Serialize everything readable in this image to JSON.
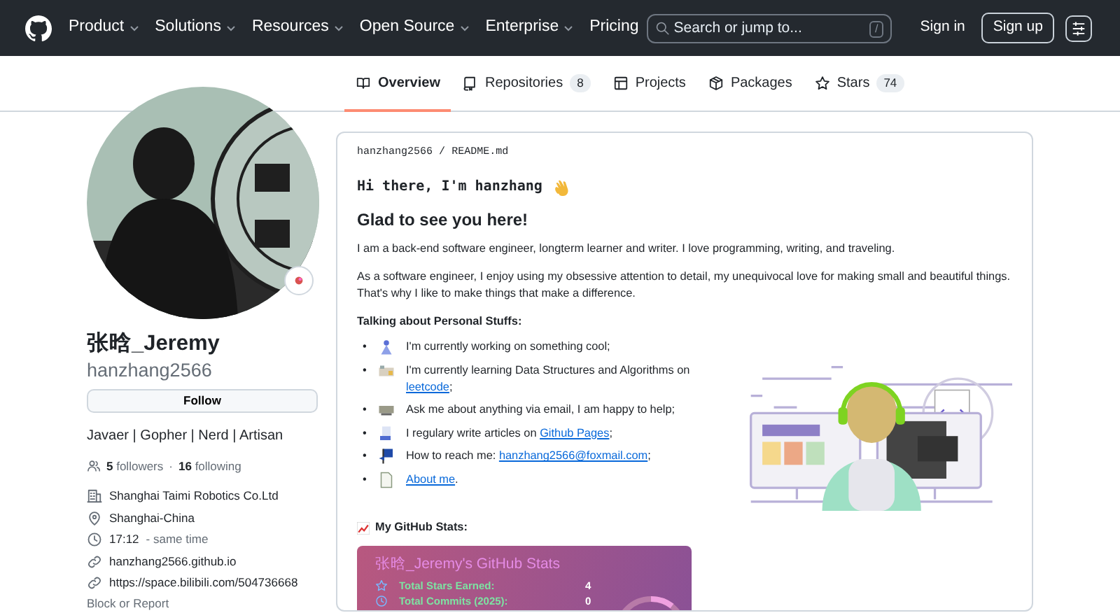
{
  "nav": {
    "items": [
      {
        "label": "Product",
        "dropdown": true
      },
      {
        "label": "Solutions",
        "dropdown": true
      },
      {
        "label": "Resources",
        "dropdown": true
      },
      {
        "label": "Open Source",
        "dropdown": true
      },
      {
        "label": "Enterprise",
        "dropdown": true
      },
      {
        "label": "Pricing",
        "dropdown": false
      }
    ],
    "search": {
      "placeholder": "Search or jump to...",
      "shortcut": "/"
    },
    "sign_in": "Sign in",
    "sign_up": "Sign up"
  },
  "tabs": [
    {
      "label": "Overview",
      "selected": true
    },
    {
      "label": "Repositories",
      "count": "8",
      "selected": false
    },
    {
      "label": "Projects",
      "selected": false
    },
    {
      "label": "Packages",
      "selected": false
    },
    {
      "label": "Stars",
      "count": "74",
      "selected": false
    }
  ],
  "profile": {
    "name": "张晗_Jeremy",
    "username": "hanzhang2566",
    "follow": "Follow",
    "bio": "Javaer | Gopher | Nerd | Artisan",
    "followers": "5",
    "followers_label": "followers",
    "separator": "·",
    "following": "16",
    "following_label": "following",
    "details": [
      {
        "text": "Shanghai Taimi Robotics Co.Ltd"
      },
      {
        "text": "Shanghai-China"
      },
      {
        "text": "17:12",
        "note": "- same time"
      },
      {
        "text": "hanzhang2566.github.io"
      },
      {
        "text": "https://space.bilibili.com/504736668"
      }
    ],
    "block": "Block or Report"
  },
  "readme": {
    "path_user": "hanzhang2566",
    "path_sep": "/",
    "path_file": "README.md",
    "greeting": "Hi there, I'm hanzhang",
    "heading": "Glad to see you here!",
    "paragraphs": [
      "I am a back-end software engineer, longterm learner and writer. I love programming, writing, and traveling.",
      "As a software engineer, I enjoy using my obsessive attention to detail, my unequivocal love for making small and beautiful things. That's why I like to make things that make a difference."
    ],
    "subheading": "Talking about Personal Stuffs:",
    "list": [
      {
        "marker": "•",
        "text": "I'm currently working on something cool;"
      },
      {
        "marker": "•",
        "text": "I'm currently learning Data Structures and Algorithms on ",
        "link": "leetcode",
        "after": ";"
      },
      {
        "marker": "•",
        "text": "Ask me about anything via email, I am happy to help;"
      },
      {
        "marker": "•",
        "text": "I regulary write articles on ",
        "link": "Github Pages",
        "after": ";"
      },
      {
        "marker": "•",
        "text": "How to reach me: ",
        "link": "hanzhang2566@foxmail.com",
        "after": ";"
      },
      {
        "marker": "•",
        "link": "About me",
        "after": "."
      }
    ],
    "stats_heading": "My GitHub Stats:",
    "stats_card": {
      "title": "张晗_Jeremy's GitHub Stats",
      "rows": [
        {
          "label": "Total Stars Earned:",
          "value": "4"
        },
        {
          "label": "Total Commits (2025):",
          "value": "0"
        }
      ]
    }
  }
}
